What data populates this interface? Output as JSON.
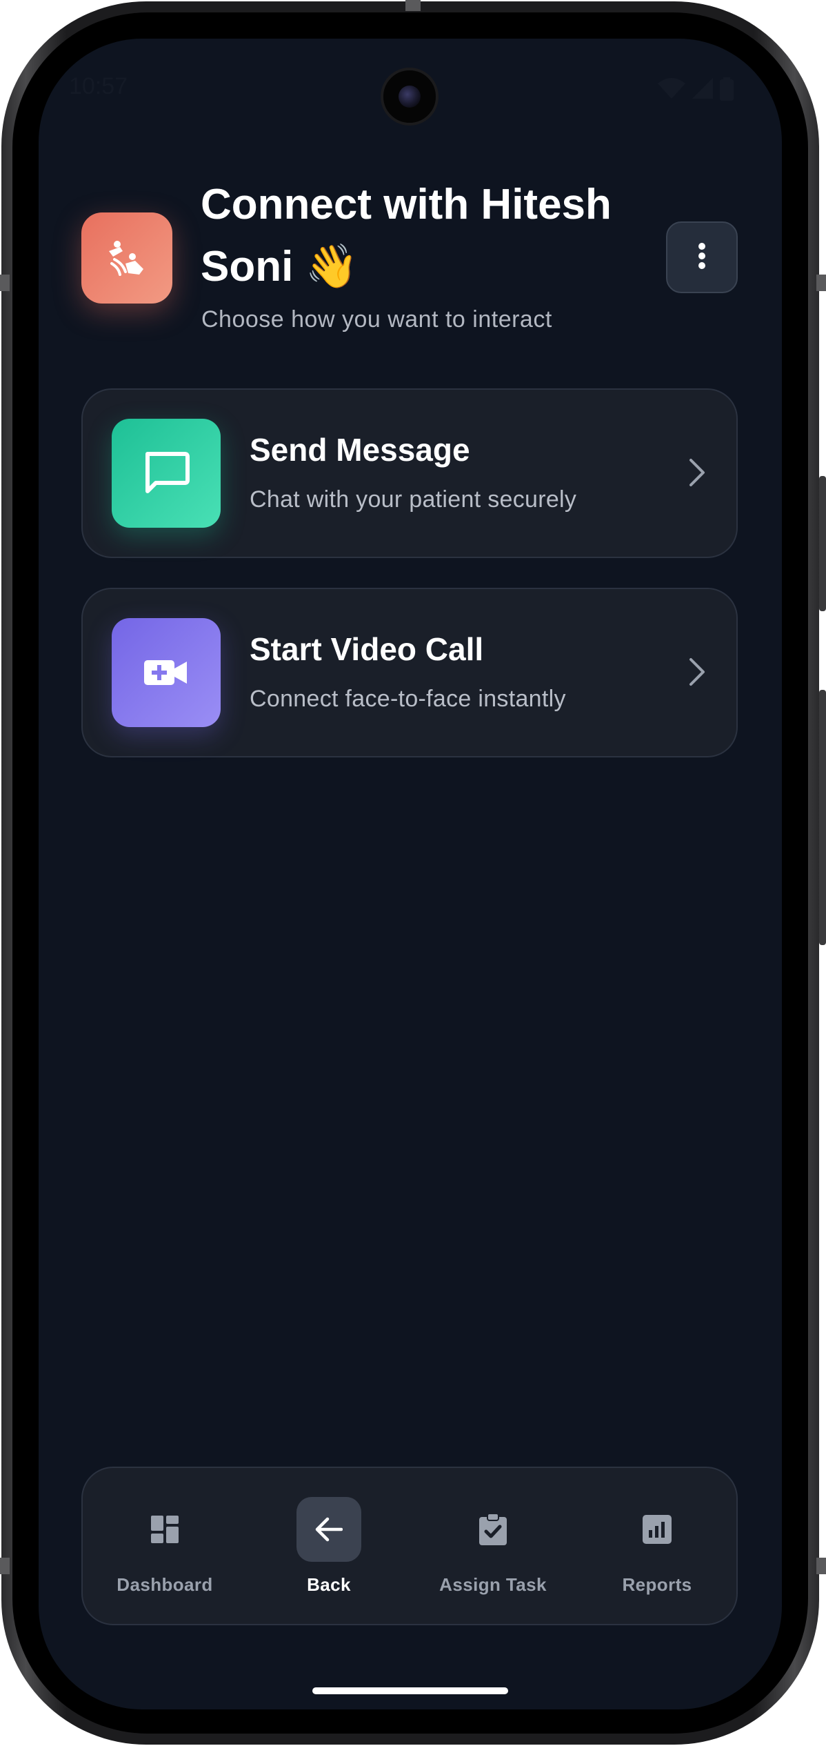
{
  "status_bar": {
    "time": "10:57"
  },
  "header": {
    "icon": "hands-waving-icon",
    "title": "Connect with Hitesh Soni 👋",
    "subtitle": "Choose how you want to interact",
    "more_icon": "more-vertical-icon"
  },
  "actions": [
    {
      "title": "Send Message",
      "description": "Chat with your patient securely",
      "icon": "chat-bubble-icon",
      "accent": "#1ec096"
    },
    {
      "title": "Start Video Call",
      "description": "Connect face-to-face instantly",
      "icon": "video-call-add-icon",
      "accent": "#7466e6"
    }
  ],
  "bottom_nav": {
    "items": [
      {
        "label": "Dashboard",
        "icon": "dashboard-icon",
        "active": false
      },
      {
        "label": "Back",
        "icon": "arrow-back-icon",
        "active": true
      },
      {
        "label": "Assign Task",
        "icon": "clipboard-check-icon",
        "active": false
      },
      {
        "label": "Reports",
        "icon": "bar-chart-icon",
        "active": false
      }
    ]
  },
  "colors": {
    "background": "#0e1420",
    "card": "#1a1f29",
    "header_accent": "#e8705e"
  }
}
